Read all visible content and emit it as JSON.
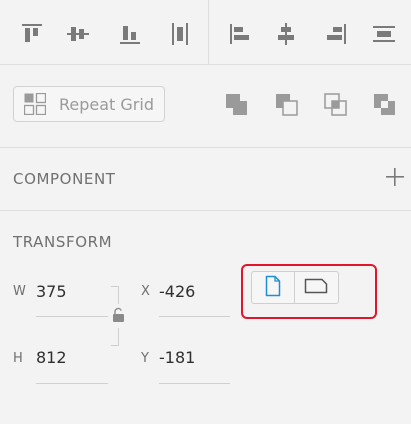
{
  "align_toolbar": {
    "icons": [
      "align-top-icon",
      "align-middle-icon",
      "align-bottom-icon",
      "distribute-vertical-icon",
      "align-left-icon",
      "align-center-icon",
      "align-right-icon",
      "distribute-horizontal-icon"
    ]
  },
  "repeat_grid": {
    "label": "Repeat Grid",
    "boolean_icons": [
      "boolean-add-icon",
      "boolean-subtract-icon",
      "boolean-intersect-icon",
      "boolean-exclude-icon"
    ]
  },
  "component": {
    "title": "COMPONENT"
  },
  "transform": {
    "title": "TRANSFORM",
    "w_label": "W",
    "w_value": "375",
    "h_label": "H",
    "h_value": "812",
    "x_label": "X",
    "x_value": "-426",
    "y_label": "Y",
    "y_value": "-181",
    "orientation": {
      "portrait_icon": "portrait-icon",
      "landscape_icon": "landscape-icon",
      "selected": "portrait"
    }
  },
  "colors": {
    "accent": "#1e8ed6",
    "highlight": "#e0162b",
    "icon": "#7a7a7a"
  }
}
